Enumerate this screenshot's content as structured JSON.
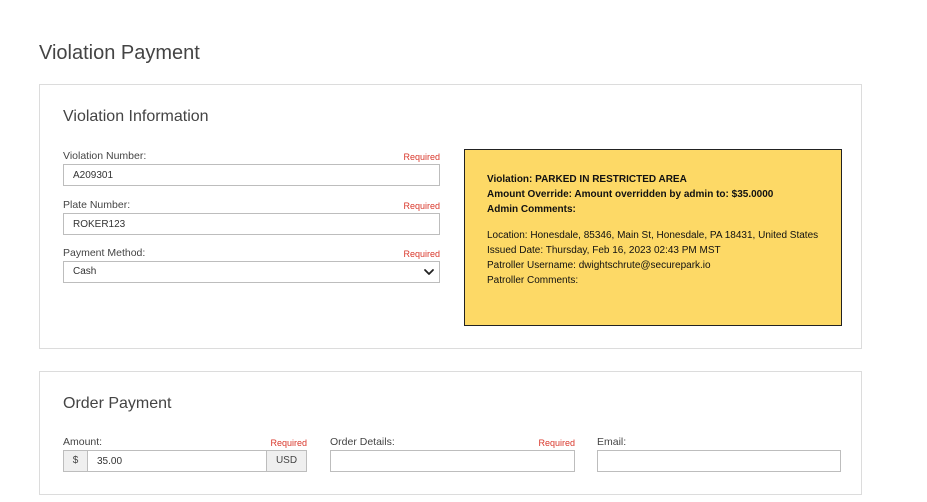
{
  "page": {
    "title": "Violation Payment"
  },
  "violation_info": {
    "title": "Violation Information",
    "violation_number": {
      "label": "Violation Number:",
      "required": "Required",
      "value": "A209301"
    },
    "plate_number": {
      "label": "Plate Number:",
      "required": "Required",
      "value": "ROKER123"
    },
    "payment_method": {
      "label": "Payment Method:",
      "required": "Required",
      "value": "Cash",
      "icon": "chevron-down-icon"
    },
    "details": {
      "violation": "Violation: PARKED IN RESTRICTED AREA",
      "amount_override": "Amount Override: Amount overridden by admin to: $35.0000",
      "admin_comments": "Admin Comments:",
      "location": "Location: Honesdale, 85346, Main St, Honesdale, PA 18431, United States",
      "issued_date": "Issued Date: Thursday, Feb 16, 2023 02:43 PM MST",
      "patroller_username": "Patroller Username: dwightschrute@securepark.io",
      "patroller_comments": "Patroller Comments:"
    }
  },
  "order_payment": {
    "title": "Order Payment",
    "amount": {
      "label": "Amount:",
      "required": "Required",
      "prefix": "$",
      "value": "35.00",
      "suffix": "USD"
    },
    "order_details": {
      "label": "Order Details:",
      "required": "Required",
      "value": ""
    },
    "email": {
      "label": "Email:",
      "value": ""
    }
  }
}
